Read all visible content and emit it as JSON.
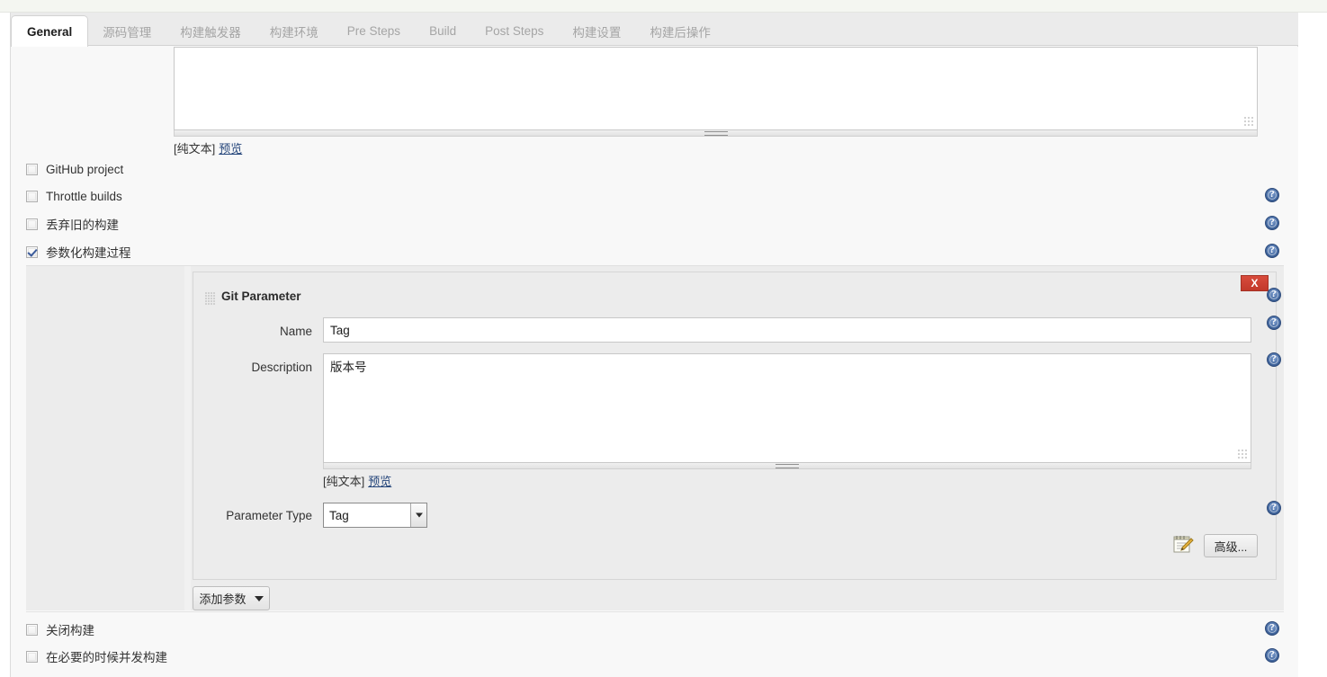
{
  "tabs": [
    {
      "label": "General",
      "active": true
    },
    {
      "label": "源码管理",
      "active": false
    },
    {
      "label": "构建触发器",
      "active": false
    },
    {
      "label": "构建环境",
      "active": false
    },
    {
      "label": "Pre Steps",
      "active": false
    },
    {
      "label": "Build",
      "active": false
    },
    {
      "label": "Post Steps",
      "active": false
    },
    {
      "label": "构建设置",
      "active": false
    },
    {
      "label": "构建后操作",
      "active": false
    }
  ],
  "job_description": {
    "value": "",
    "plain_text_label": "[纯文本]",
    "preview_label": "预览"
  },
  "options": [
    {
      "label": "GitHub project",
      "checked": false
    },
    {
      "label": "Throttle builds",
      "checked": false
    },
    {
      "label": "丢弃旧的构建",
      "checked": false
    },
    {
      "label": "参数化构建过程",
      "checked": true
    }
  ],
  "git_parameter": {
    "title": "Git Parameter",
    "close_label": "X",
    "name_label": "Name",
    "name_value": "Tag",
    "description_label": "Description",
    "description_value": "版本号",
    "description_plain_text_label": "[纯文本]",
    "description_preview_label": "预览",
    "parameter_type_label": "Parameter Type",
    "parameter_type_value": "Tag",
    "parameter_type_options": [
      "Tag"
    ],
    "advanced_label": "高级..."
  },
  "add_parameter": {
    "label": "添加参数"
  },
  "bottom_options": [
    {
      "label": "关闭构建",
      "checked": false
    },
    {
      "label": "在必要的时候并发构建",
      "checked": false
    }
  ],
  "colors": {
    "page_bg": "#f8f8f8",
    "panel_bg": "#ececec",
    "tabbar_bg": "#ebebeb",
    "active_tab_bg": "#ffffff",
    "tab_text": "#a5a5a5",
    "active_tab_text": "#1c1c1c",
    "link": "#24457a",
    "delete_button": "#c2392b",
    "help_icon": "#43689f"
  }
}
